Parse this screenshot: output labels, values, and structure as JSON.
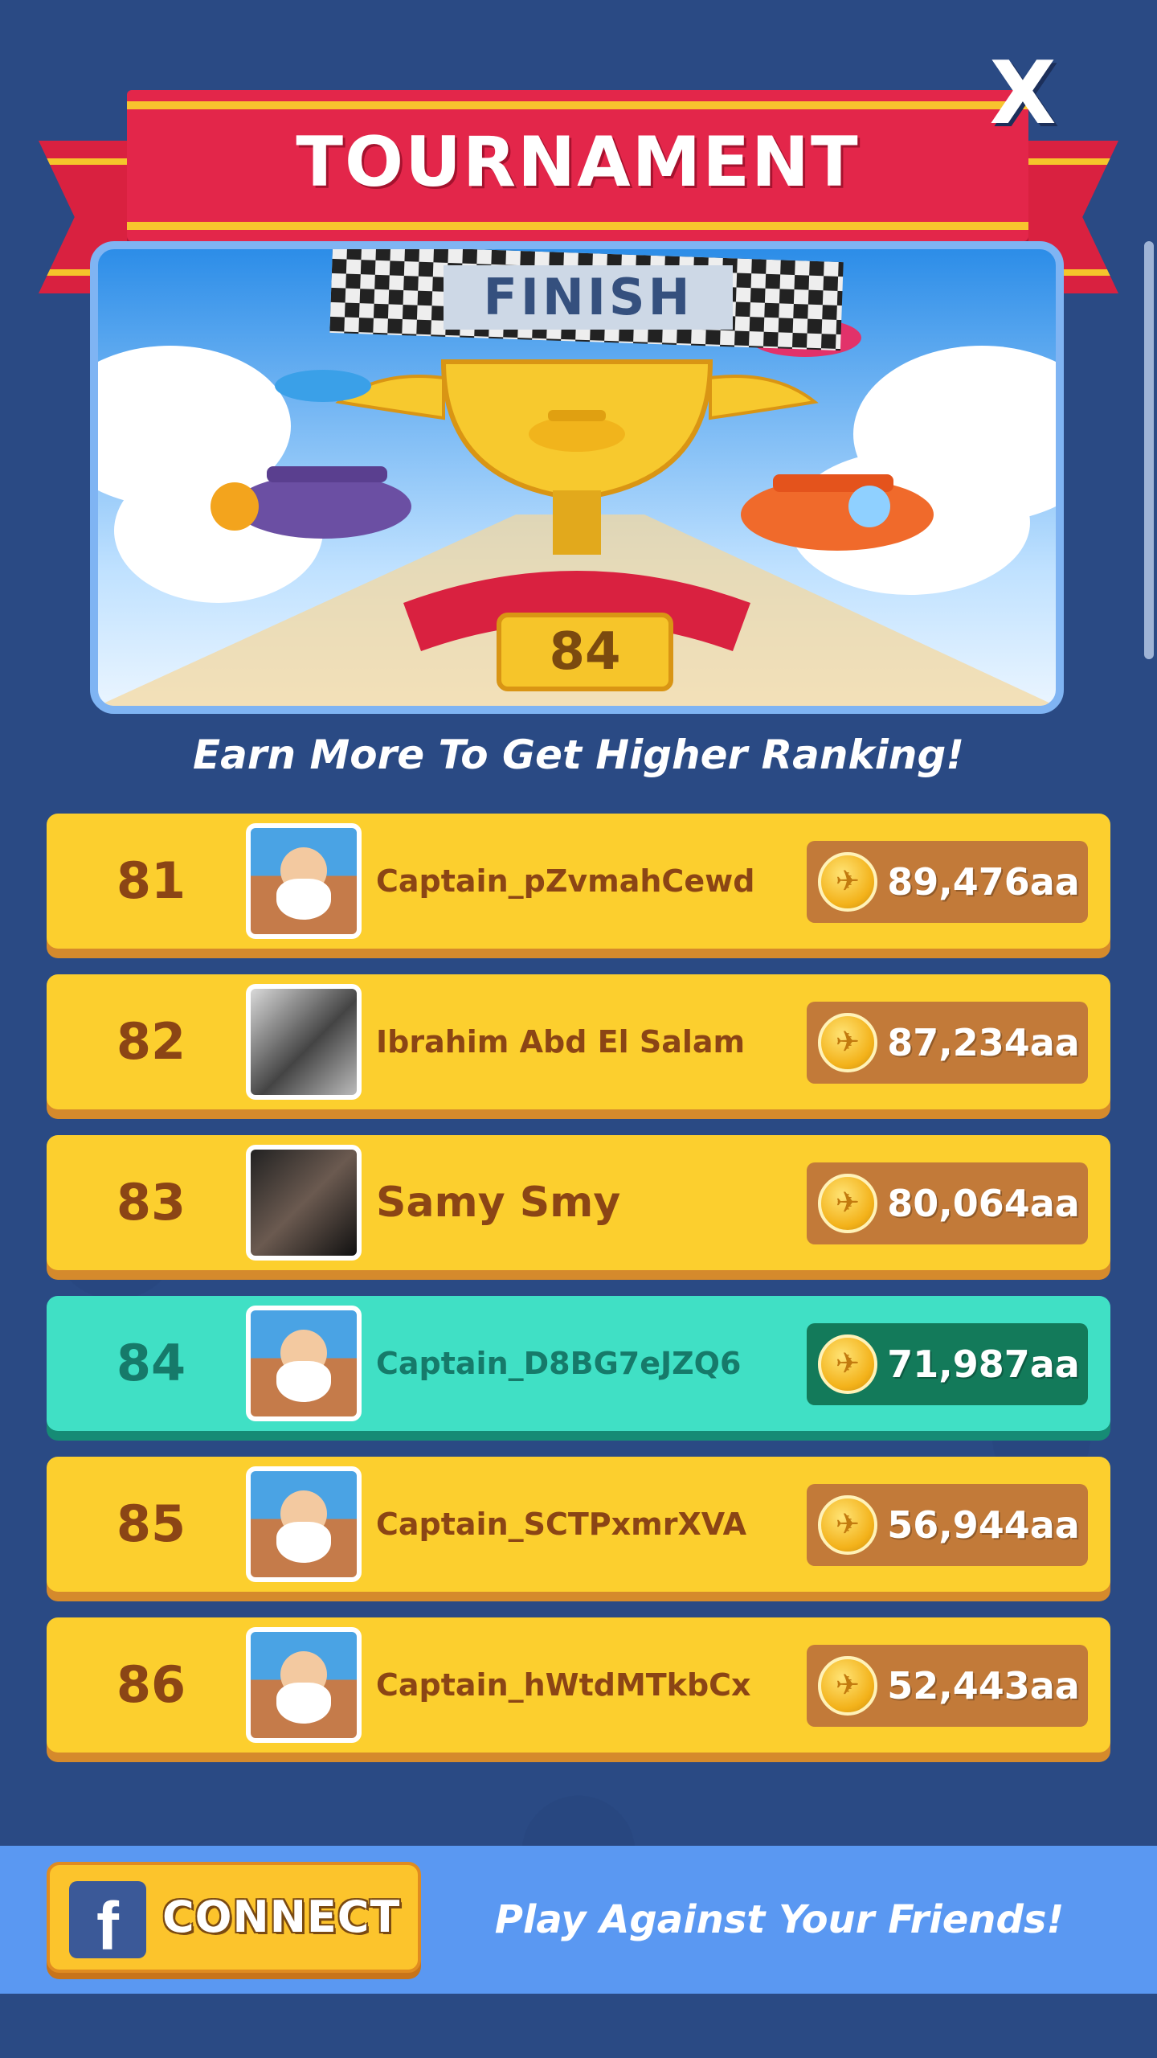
{
  "banner": {
    "title": "TOURNAMENT",
    "close_label": "X"
  },
  "hero": {
    "finish_label": "FINISH",
    "trophy_rank": "84"
  },
  "subtitle": "Earn More To Get Higher Ranking!",
  "leaderboard": [
    {
      "rank": "81",
      "name": "Captain_pZvmahCewd",
      "score": "89,476aa",
      "avatar": "captain-avatar",
      "highlight": false
    },
    {
      "rank": "82",
      "name": "Ibrahim Abd El Salam",
      "score": "87,234aa",
      "avatar": "photo-avatar",
      "highlight": false
    },
    {
      "rank": "83",
      "name": "Samy Smy",
      "score": "80,064aa",
      "avatar": "photo-avatar",
      "highlight": false
    },
    {
      "rank": "84",
      "name": "Captain_D8BG7eJZQ6",
      "score": "71,987aa",
      "avatar": "captain-avatar",
      "highlight": true
    },
    {
      "rank": "85",
      "name": "Captain_SCTPxmrXVA",
      "score": "56,944aa",
      "avatar": "captain-avatar",
      "highlight": false
    },
    {
      "rank": "86",
      "name": "Captain_hWtdMTkbCx",
      "score": "52,443aa",
      "avatar": "captain-avatar",
      "highlight": false
    }
  ],
  "footer": {
    "connect_label": "CONNECT",
    "facebook_icon": "facebook-icon",
    "tagline": "Play Against Your Friends!"
  },
  "colors": {
    "background": "#2a4a84",
    "row": "#fccf2e",
    "row_highlight": "#40e0c5",
    "ribbon": "#e3264a",
    "footer": "#5a98f2"
  }
}
